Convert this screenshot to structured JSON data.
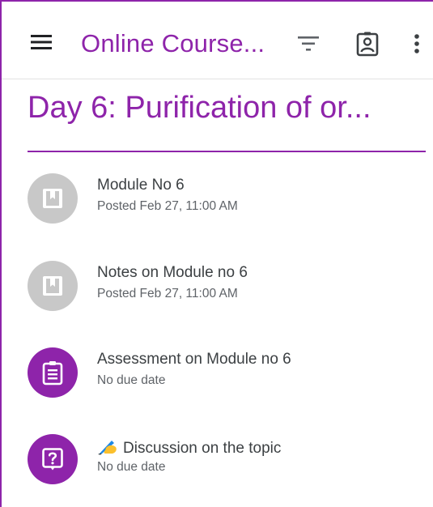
{
  "appbar": {
    "title": "Online Course...",
    "menu_icon": "hamburger-menu-icon",
    "filter_icon": "filter-icon",
    "people_icon": "assignment-ind-icon",
    "more_icon": "more-vert-icon"
  },
  "topic": {
    "title": "Day 6: Purification of or..."
  },
  "items": [
    {
      "title": "Module No 6",
      "subtitle": "Posted Feb 27, 11:00 AM",
      "icon": "material-book-icon",
      "color": "#c8c8c8"
    },
    {
      "title": "Notes on Module no 6",
      "subtitle": "Posted Feb 27, 11:00 AM",
      "icon": "material-book-icon",
      "color": "#c8c8c8"
    },
    {
      "title": "Assessment on Module no 6",
      "subtitle": "No due date",
      "icon": "assignment-clipboard-icon",
      "color": "#8e24aa"
    },
    {
      "title": "Discussion on the topic",
      "subtitle": "No due date",
      "icon": "question-icon",
      "emoji": "writing-hand-icon",
      "color": "#8e24aa"
    }
  ],
  "colors": {
    "accent": "#8e24aa",
    "material_grey": "#c8c8c8",
    "text_primary": "#3c4043",
    "text_secondary": "#5f6368"
  }
}
